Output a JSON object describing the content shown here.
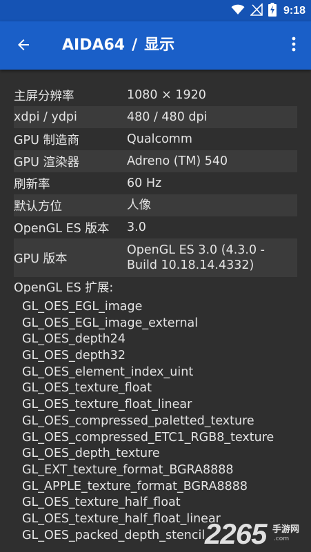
{
  "status_bar": {
    "time": "9:18",
    "icons": [
      "wifi-icon",
      "signal-icon",
      "battery-charging-icon"
    ]
  },
  "app_bar": {
    "app_name": "AIDA64",
    "separator": "/",
    "page_title": "显示",
    "back_icon": "arrow-back-icon",
    "menu_icon": "more-vert-icon"
  },
  "info_rows": [
    {
      "label": "主屏分辨率",
      "value": "1080 × 1920"
    },
    {
      "label": "xdpi / ydpi",
      "value": "480 / 480 dpi"
    },
    {
      "label": "GPU 制造商",
      "value": "Qualcomm"
    },
    {
      "label": "GPU 渲染器",
      "value": "Adreno (TM) 540"
    },
    {
      "label": "刷新率",
      "value": "60 Hz"
    },
    {
      "label": "默认方位",
      "value": "人像"
    },
    {
      "label": "OpenGL ES 版本",
      "value": "3.0"
    },
    {
      "label": "GPU 版本",
      "value_line1": "OpenGL ES 3.0 (4.3.0 -",
      "value_line2": "Build 10.18.14.4332)"
    }
  ],
  "extensions": {
    "header": "OpenGL ES 扩展:",
    "items": [
      "GL_OES_EGL_image",
      "GL_OES_EGL_image_external",
      "GL_OES_depth24",
      "GL_OES_depth32",
      "GL_OES_element_index_uint",
      "GL_OES_texture_float",
      "GL_OES_texture_float_linear",
      "GL_OES_compressed_paletted_texture",
      "GL_OES_compressed_ETC1_RGB8_texture",
      "GL_OES_depth_texture",
      "GL_EXT_texture_format_BGRA8888",
      "GL_APPLE_texture_format_BGRA8888",
      "GL_OES_texture_half_float",
      "GL_OES_texture_half_float_linear",
      "GL_OES_packed_depth_stencil"
    ]
  },
  "watermark": {
    "number": "2265",
    "text": "手游网",
    "sub": ".com"
  },
  "colors": {
    "status_bar": "#1553b4",
    "app_bar": "#1a5fc8",
    "background": "#2f2f2f",
    "row_alt": "#3b3b3b",
    "text": "#e4e4e4"
  }
}
